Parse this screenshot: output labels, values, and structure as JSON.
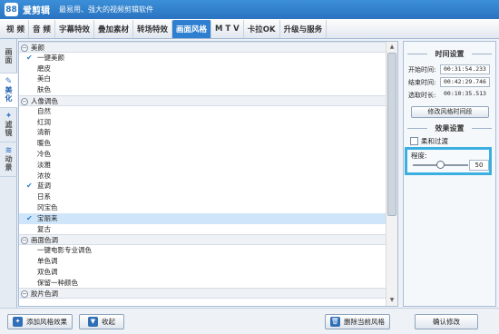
{
  "app": {
    "logo_text": "88",
    "title": "爱剪辑",
    "slogan": "最易用、强大的视频剪辑软件"
  },
  "tabs": [
    {
      "label": "视  频",
      "active": false
    },
    {
      "label": "音  频",
      "active": false
    },
    {
      "label": "字幕特效",
      "active": false
    },
    {
      "label": "叠加素材",
      "active": false
    },
    {
      "label": "转场特效",
      "active": false
    },
    {
      "label": "画面风格",
      "active": true
    },
    {
      "label": "M T V",
      "active": false
    },
    {
      "label": "卡拉OK",
      "active": false
    },
    {
      "label": "升级与服务",
      "active": false
    }
  ],
  "side_tabs": [
    {
      "label": "画面",
      "icon": "",
      "active": false
    },
    {
      "label": "美化",
      "icon": "✎",
      "active": true
    },
    {
      "label": "滤镜",
      "icon": "✦",
      "active": false
    },
    {
      "label": "动景",
      "icon": "≋",
      "active": false
    }
  ],
  "style_list": [
    {
      "type": "category",
      "label": "美颜"
    },
    {
      "type": "item",
      "label": "一键美颜",
      "checked": true,
      "selected": false
    },
    {
      "type": "item",
      "label": "磨皮",
      "checked": false,
      "selected": false
    },
    {
      "type": "item",
      "label": "美白",
      "checked": false,
      "selected": false
    },
    {
      "type": "item",
      "label": "肤色",
      "checked": false,
      "selected": false
    },
    {
      "type": "category",
      "label": "人像调色"
    },
    {
      "type": "item",
      "label": "自然",
      "checked": false,
      "selected": false
    },
    {
      "type": "item",
      "label": "红润",
      "checked": false,
      "selected": false
    },
    {
      "type": "item",
      "label": "清新",
      "checked": false,
      "selected": false
    },
    {
      "type": "item",
      "label": "暖色",
      "checked": false,
      "selected": false
    },
    {
      "type": "item",
      "label": "冷色",
      "checked": false,
      "selected": false
    },
    {
      "type": "item",
      "label": "淡雅",
      "checked": false,
      "selected": false
    },
    {
      "type": "item",
      "label": "浓妆",
      "checked": false,
      "selected": false
    },
    {
      "type": "item",
      "label": "蓝调",
      "checked": true,
      "selected": false
    },
    {
      "type": "item",
      "label": "日系",
      "checked": false,
      "selected": false
    },
    {
      "type": "item",
      "label": "冈宝色",
      "checked": false,
      "selected": false
    },
    {
      "type": "item",
      "label": "宝丽来",
      "checked": true,
      "selected": true
    },
    {
      "type": "item",
      "label": "复古",
      "checked": false,
      "selected": false
    },
    {
      "type": "category",
      "label": "画面色调"
    },
    {
      "type": "item",
      "label": "一键电影专业调色",
      "checked": false,
      "selected": false
    },
    {
      "type": "item",
      "label": "单色调",
      "checked": false,
      "selected": false
    },
    {
      "type": "item",
      "label": "双色调",
      "checked": false,
      "selected": false
    },
    {
      "type": "item",
      "label": "保留一种颜色",
      "checked": false,
      "selected": false
    },
    {
      "type": "category",
      "label": "胶片色调"
    }
  ],
  "time_settings": {
    "title": "时间设置",
    "start_label": "开始时间:",
    "start_value": "00:31:54.233",
    "end_label": "结束时间:",
    "end_value": "00:42:29.746",
    "duration_label": "选取时长:",
    "duration_value": "00:10:35.513",
    "modify_button": "修改风格时间段"
  },
  "effect_settings": {
    "title": "效果设置",
    "soft_transition_label": "柔和过渡",
    "soft_transition_checked": false,
    "degree_label": "程度:",
    "degree_value": "50",
    "degree_fraction": 0.5
  },
  "bottom_buttons": {
    "add_style": "添加风格效果",
    "collapse": "收起",
    "delete_style": "删除当前风格",
    "confirm": "确认修改"
  },
  "icons": {
    "add_icon": "✦",
    "collapse_icon": "▼",
    "delete_icon": "🗑",
    "check_mark": "✔"
  },
  "colors": {
    "title_bar": "#2a73c0",
    "active_tab": "#2f7fd0",
    "selected_row": "#cfe5fa",
    "highlight_box": "#3bb0e0"
  }
}
